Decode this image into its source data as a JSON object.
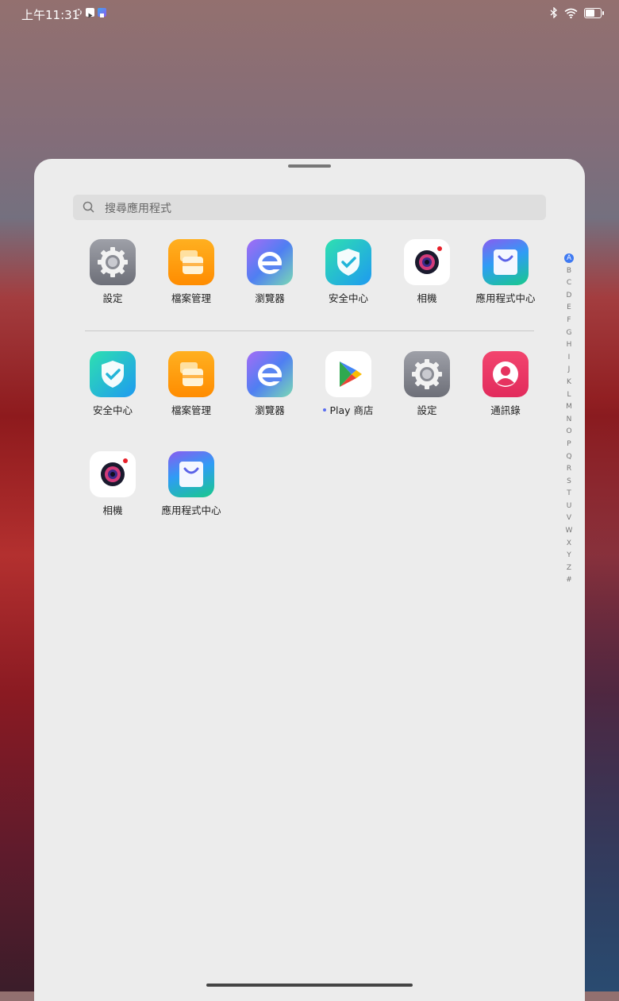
{
  "status_bar": {
    "time": "上午11:31",
    "battery_level": 0.7
  },
  "search": {
    "placeholder": "搜尋應用程式"
  },
  "recent_apps": [
    {
      "label": "設定",
      "icon": "settings-icon"
    },
    {
      "label": "檔案管理",
      "icon": "files-icon"
    },
    {
      "label": "瀏覽器",
      "icon": "browser-icon"
    },
    {
      "label": "安全中心",
      "icon": "security-icon"
    },
    {
      "label": "相機",
      "icon": "camera-icon"
    },
    {
      "label": "應用程式中心",
      "icon": "app-center-icon"
    }
  ],
  "all_apps": [
    {
      "label": "安全中心",
      "icon": "security-icon"
    },
    {
      "label": "檔案管理",
      "icon": "files-icon"
    },
    {
      "label": "瀏覽器",
      "icon": "browser-icon"
    },
    {
      "label": "Play 商店",
      "icon": "play-store-icon",
      "new_dot": true
    },
    {
      "label": "設定",
      "icon": "settings-icon"
    },
    {
      "label": "通訊錄",
      "icon": "contacts-icon"
    },
    {
      "label": "相機",
      "icon": "camera-icon"
    },
    {
      "label": "應用程式中心",
      "icon": "app-center-icon"
    }
  ],
  "alpha_index": [
    "A",
    "B",
    "C",
    "D",
    "E",
    "F",
    "G",
    "H",
    "I",
    "J",
    "K",
    "L",
    "M",
    "N",
    "O",
    "P",
    "Q",
    "R",
    "S",
    "T",
    "U",
    "V",
    "W",
    "X",
    "Y",
    "Z",
    "#"
  ],
  "alpha_active": "A",
  "colors": {
    "accent": "#3f7af2",
    "new_dot": "#5a6df0"
  }
}
